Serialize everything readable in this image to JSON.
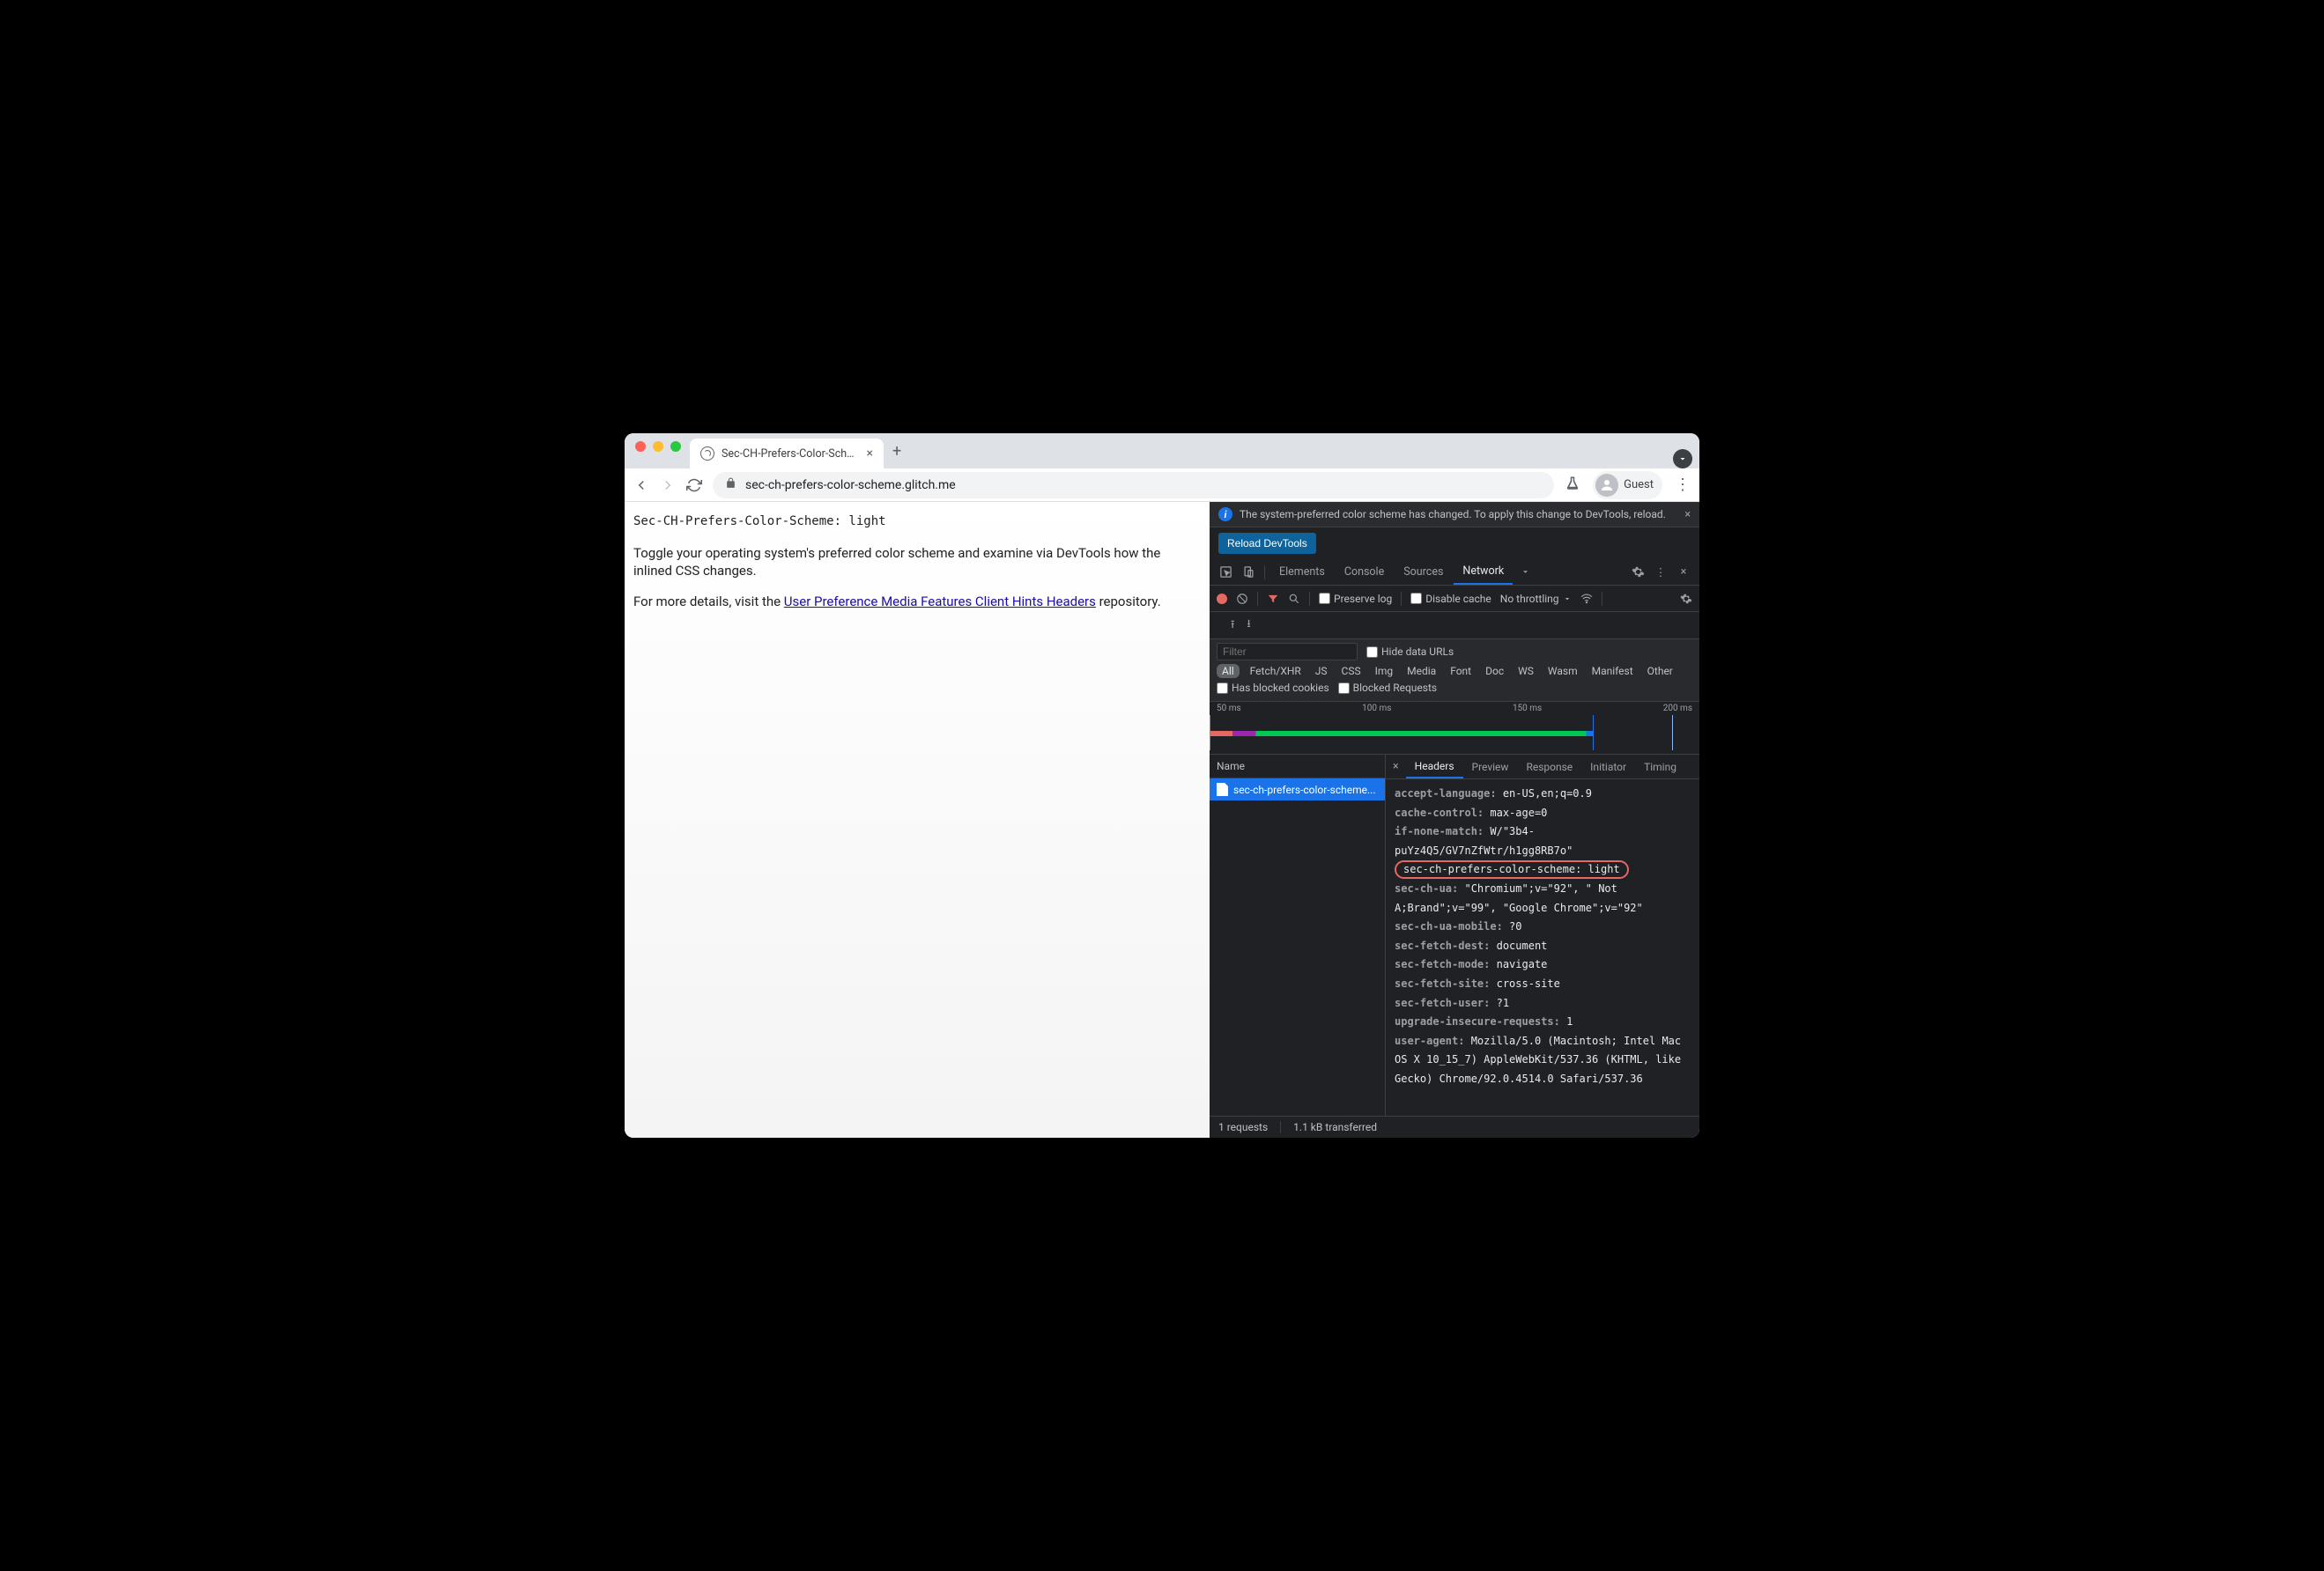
{
  "tab": {
    "title": "Sec-CH-Prefers-Color-Scheme"
  },
  "toolbar": {
    "url": "sec-ch-prefers-color-scheme.glitch.me",
    "profile_label": "Guest"
  },
  "page": {
    "header_line": "Sec-CH-Prefers-Color-Scheme: light",
    "para1": "Toggle your operating system's preferred color scheme and examine via DevTools how the inlined CSS changes.",
    "para2_before": "For more details, visit the ",
    "para2_link": "User Preference Media Features Client Hints Headers",
    "para2_after": " repository."
  },
  "devtools": {
    "info_message": "The system-preferred color scheme has changed. To apply this change to DevTools, reload.",
    "reload_button": "Reload DevTools",
    "tabs": {
      "elements": "Elements",
      "console": "Console",
      "sources": "Sources",
      "network": "Network"
    },
    "net_toolbar": {
      "preserve_log": "Preserve log",
      "disable_cache": "Disable cache",
      "throttling": "No throttling"
    },
    "filter": {
      "placeholder": "Filter",
      "hide_data_urls": "Hide data URLs",
      "chips": [
        "All",
        "Fetch/XHR",
        "JS",
        "CSS",
        "Img",
        "Media",
        "Font",
        "Doc",
        "WS",
        "Wasm",
        "Manifest",
        "Other"
      ],
      "blocked_cookies": "Has blocked cookies",
      "blocked_requests": "Blocked Requests"
    },
    "timeline_ticks": [
      "50 ms",
      "100 ms",
      "150 ms",
      "200 ms"
    ],
    "netlist": {
      "name_header": "Name",
      "rows": [
        "sec-ch-prefers-color-scheme..."
      ]
    },
    "detail_tabs": {
      "headers": "Headers",
      "preview": "Preview",
      "response": "Response",
      "initiator": "Initiator",
      "timing": "Timing"
    },
    "headers": [
      {
        "k": "accept-language:",
        "v": " en-US,en;q=0.9"
      },
      {
        "k": "cache-control:",
        "v": " max-age=0"
      },
      {
        "k": "if-none-match:",
        "v": " W/\"3b4-puYz4Q5/GV7nZfWtr/h1gg8RB7o\""
      },
      {
        "k": "sec-ch-prefers-color-scheme:",
        "v": " light",
        "highlight": true
      },
      {
        "k": "sec-ch-ua:",
        "v": " \"Chromium\";v=\"92\", \" Not A;Brand\";v=\"99\", \"Google Chrome\";v=\"92\""
      },
      {
        "k": "sec-ch-ua-mobile:",
        "v": " ?0"
      },
      {
        "k": "sec-fetch-dest:",
        "v": " document"
      },
      {
        "k": "sec-fetch-mode:",
        "v": " navigate"
      },
      {
        "k": "sec-fetch-site:",
        "v": " cross-site"
      },
      {
        "k": "sec-fetch-user:",
        "v": " ?1"
      },
      {
        "k": "upgrade-insecure-requests:",
        "v": " 1"
      },
      {
        "k": "user-agent:",
        "v": " Mozilla/5.0 (Macintosh; Intel Mac OS X 10_15_7) AppleWebKit/537.36 (KHTML, like Gecko) Chrome/92.0.4514.0 Safari/537.36"
      }
    ],
    "status": {
      "requests": "1 requests",
      "transferred": "1.1 kB transferred"
    }
  }
}
